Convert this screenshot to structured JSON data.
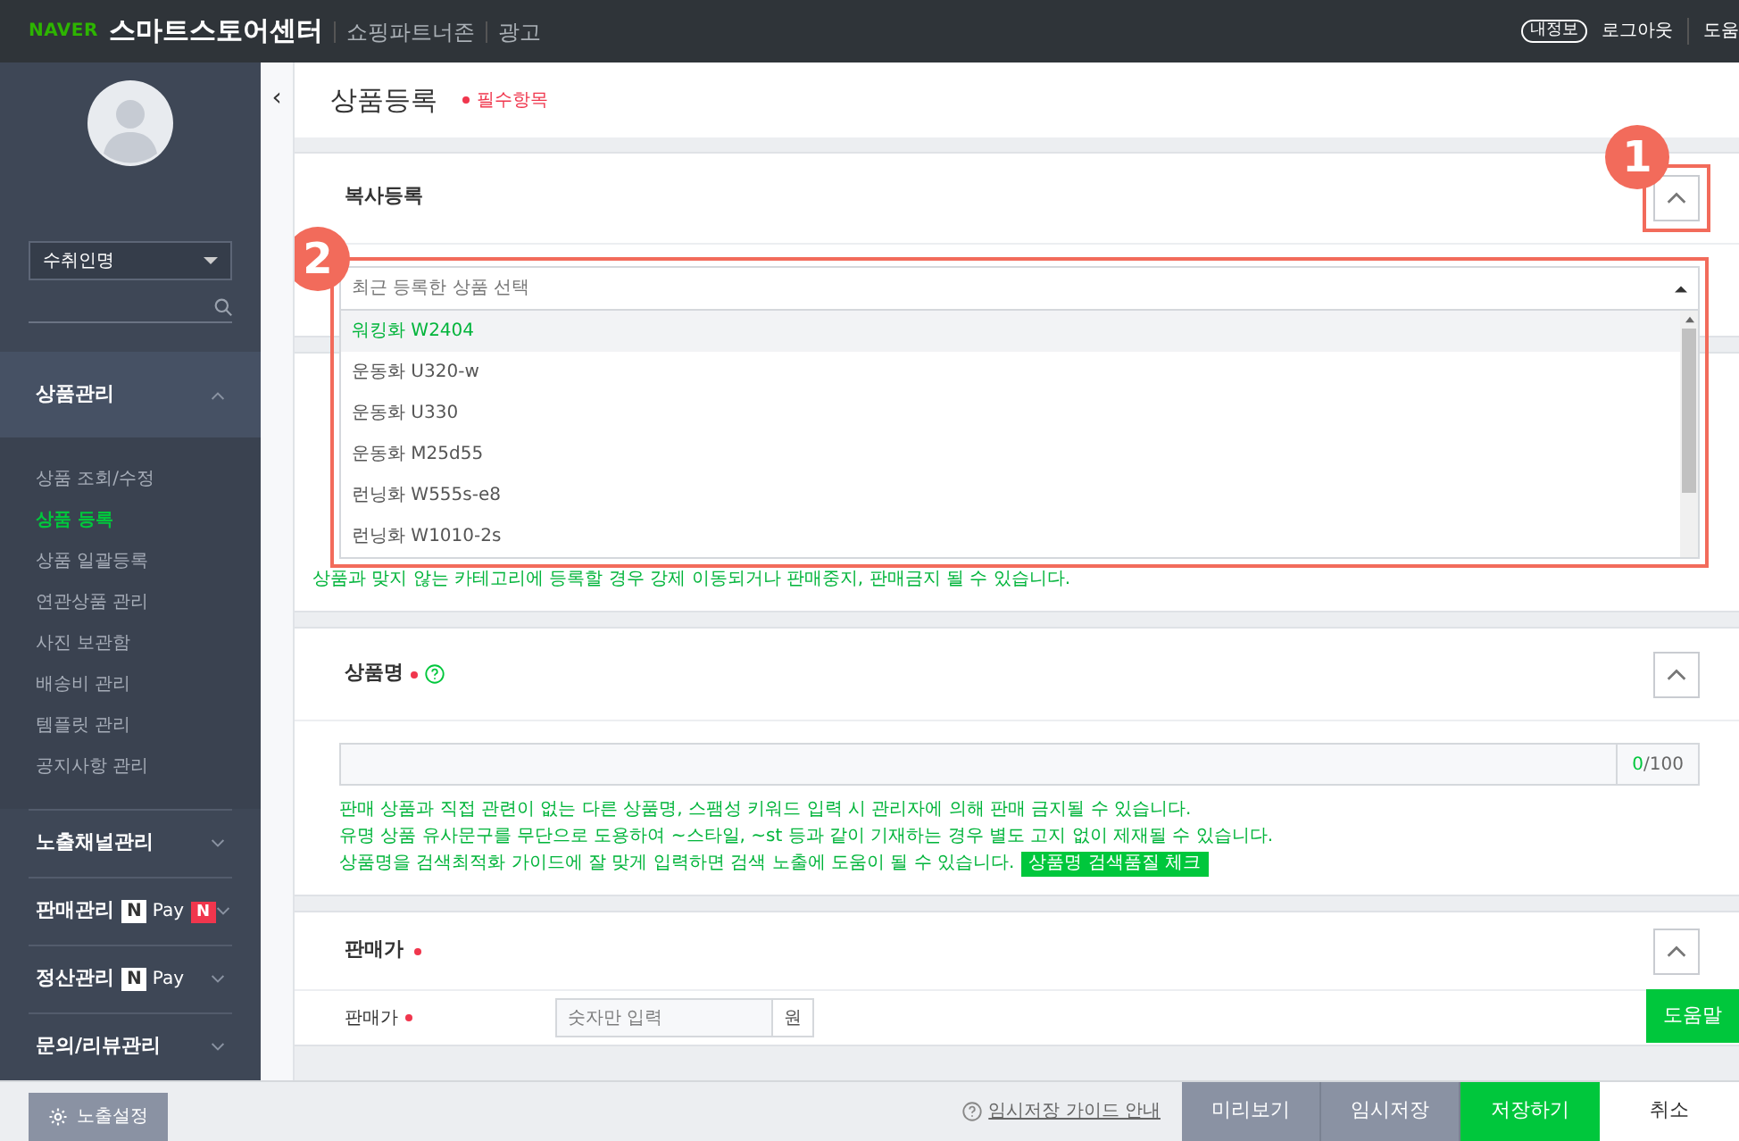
{
  "header": {
    "brand": "NAVER",
    "title": "스마트스토어센터",
    "links": [
      "쇼핑파트너존",
      "광고"
    ],
    "my_info": "내정보",
    "logout": "로그아웃",
    "help": "도움"
  },
  "sidebar": {
    "select": "수취인명",
    "toggle": "‹",
    "menu": [
      {
        "label": "상품관리",
        "expanded": true,
        "children": [
          {
            "label": "상품 조회/수정",
            "selected": false
          },
          {
            "label": "상품 등록",
            "selected": true
          },
          {
            "label": "상품 일괄등록",
            "selected": false
          },
          {
            "label": "연관상품 관리",
            "selected": false
          },
          {
            "label": "사진 보관함",
            "selected": false
          },
          {
            "label": "배송비 관리",
            "selected": false
          },
          {
            "label": "템플릿 관리",
            "selected": false
          },
          {
            "label": "공지사항 관리",
            "selected": false
          }
        ]
      },
      {
        "label": "노출채널관리",
        "expanded": false
      },
      {
        "label": "판매관리",
        "expanded": false,
        "badges": [
          {
            "kind": "npay",
            "mark": "N",
            "text": "Pay"
          },
          {
            "kind": "new",
            "text": "N"
          }
        ]
      },
      {
        "label": "정산관리",
        "expanded": false,
        "badges": [
          {
            "kind": "npay",
            "mark": "N",
            "text": "Pay"
          }
        ]
      },
      {
        "label": "문의/리뷰관리",
        "expanded": false
      }
    ]
  },
  "page": {
    "title": "상품등록",
    "required_label": "필수항목"
  },
  "copy_section": {
    "title": "복사등록",
    "expanded": true,
    "callout": "1",
    "select": {
      "placeholder": "최근 등록한 상품 선택",
      "open": true,
      "callout": "2",
      "options": [
        {
          "label": "워킹화 W2404",
          "selected": true
        },
        {
          "label": "운동화 U320-w",
          "selected": false
        },
        {
          "label": "운동화 U330",
          "selected": false
        },
        {
          "label": "운동화 M25d55",
          "selected": false
        },
        {
          "label": "런닝화 W555s-e8",
          "selected": false
        },
        {
          "label": "런닝화 W1010-2s",
          "selected": false
        }
      ]
    }
  },
  "category_notice": "상품과 맞지 않는 카테고리에 등록할 경우 강제 이동되거나 판매중지, 판매금지 될 수 있습니다.",
  "name_section": {
    "title": "상품명",
    "required": true,
    "expanded": true,
    "count": "0",
    "limit": "/100",
    "help_lines": [
      "판매 상품과 직접 관련이 없는 다른 상품명, 스팸성 키워드 입력 시 관리자에 의해 판매 금지될 수 있습니다.",
      "유명 상품 유사문구를 무단으로 도용하여 ~스타일, ~st 등과 같이 기재하는 경우 별도 고지 없이 제재될 수 있습니다.",
      "상품명을 검색최적화 가이드에 잘 맞게 입력하면 검색 노출에 도움이 될 수 있습니다."
    ],
    "check_button": "상품명 검색품질 체크"
  },
  "price_section": {
    "title": "판매가",
    "required": true,
    "expanded": true,
    "field_label": "판매가",
    "field_required": true,
    "placeholder": "숫자만 입력",
    "unit": "원"
  },
  "help_button": "도움말",
  "footer": {
    "settings_button": "노출설정",
    "guide_link": "임시저장 가이드 안내",
    "buttons": [
      {
        "label": "미리보기",
        "kind": "secondary"
      },
      {
        "label": "임시저장",
        "kind": "secondary"
      },
      {
        "label": "저장하기",
        "kind": "primary"
      },
      {
        "label": "취소",
        "kind": "plain"
      }
    ]
  }
}
